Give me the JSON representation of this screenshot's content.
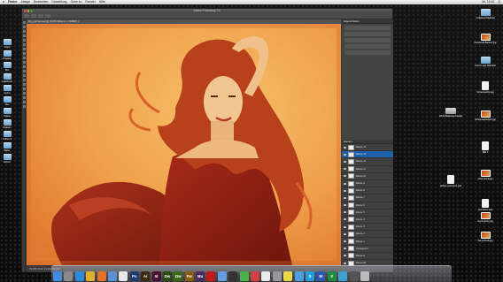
{
  "menubar": {
    "apple": "",
    "app": "Finder",
    "items": [
      "Ablage",
      "Bearbeiten",
      "Darstellung",
      "Gehe zu",
      "Fenster",
      "Hilfe"
    ],
    "status": [
      "Mi. 16:42",
      "Q"
    ]
  },
  "photoshop": {
    "window_title": "Adobe Photoshop CC",
    "doc_tab": "fire_portrait.psd @ 33,3% (Ebene 1, RGB/8) ×",
    "status": "33,33%  Dok: 24,3M/156,8M",
    "panel_title": "Eigenschaften",
    "layers_title": "Ebenen",
    "layers": [
      "Ebene 14",
      "Ebene 13",
      "Ebene 12",
      "Ebene 11",
      "Ebene 10",
      "Ebene 9",
      "Ebene 8",
      "Ebene 7",
      "Ebene 6",
      "Ebene 5",
      "Ebene 4",
      "Ebene 3",
      "Ebene 2",
      "Ebene 1",
      "Hintergrund",
      "Ebene 0",
      "Ebene 00"
    ]
  },
  "desktop_left": [
    "Fotos",
    "Projekte",
    "Mix",
    "Lakehurst",
    "Archiv",
    "Neu",
    "Ordner",
    "Dateien",
    "Ordner 2",
    "Bilder",
    "Export"
  ],
  "desktop_right": [
    "Collateral Material",
    "Facebook-Banner.jpg",
    "Fotos Lupe Stilmittel",
    "Scheinwerfer.jpg",
    "Work Backstep Festplatte",
    "Scheinwerferlicht.jpg",
    "Bild 1",
    "pixel-stock.jpg",
    "adobe-extension.psd",
    "animation.psd",
    "stock-photo.jpg",
    "fire-portrait.jpg"
  ],
  "dock_apps": [
    {
      "name": "finder-icon",
      "label": "",
      "color": "#3d8ee0"
    },
    {
      "name": "launchpad-icon",
      "label": "",
      "color": "#8a8a8a"
    },
    {
      "name": "safari-icon",
      "label": "",
      "color": "#2a8be0"
    },
    {
      "name": "chrome-icon",
      "label": "",
      "color": "#dfb22a"
    },
    {
      "name": "firefox-icon",
      "label": "",
      "color": "#e5702a"
    },
    {
      "name": "mail-icon",
      "label": "",
      "color": "#5b8fd8"
    },
    {
      "name": "calendar-icon",
      "label": "",
      "color": "#e8e8e8"
    },
    {
      "name": "photoshop-icon",
      "label": "Ps",
      "color": "#1e3c6e"
    },
    {
      "name": "illustrator-icon",
      "label": "Ai",
      "color": "#3a2810"
    },
    {
      "name": "indesign-icon",
      "label": "Id",
      "color": "#4a1030"
    },
    {
      "name": "dreamweaver-icon",
      "label": "Dw",
      "color": "#2a4a10"
    },
    {
      "name": "dreamweaver2-icon",
      "label": "Dw",
      "color": "#3a6a18"
    },
    {
      "name": "fireworks-icon",
      "label": "Fw",
      "color": "#8a5a10"
    },
    {
      "name": "muse-icon",
      "label": "Mu",
      "color": "#4a2a60"
    },
    {
      "name": "acrobat-icon",
      "label": "",
      "color": "#c01a1a"
    },
    {
      "name": "itunes-icon",
      "label": "",
      "color": "#6a9ae0"
    },
    {
      "name": "music-icon",
      "label": "",
      "color": "#333333"
    },
    {
      "name": "messages-icon",
      "label": "",
      "color": "#4ab04a"
    },
    {
      "name": "app-icon-1",
      "label": "",
      "color": "#d04040"
    },
    {
      "name": "app-icon-2",
      "label": "",
      "color": "#eaeaea"
    },
    {
      "name": "app-icon-3",
      "label": "",
      "color": "#999999"
    },
    {
      "name": "app-icon-4",
      "label": "",
      "color": "#e8d84a"
    },
    {
      "name": "app-icon-5",
      "label": "",
      "color": "#50a0e0"
    },
    {
      "name": "skype-icon",
      "label": "S",
      "color": "#1da0e0"
    },
    {
      "name": "word-icon",
      "label": "W",
      "color": "#2a5ab0"
    },
    {
      "name": "excel-icon",
      "label": "X",
      "color": "#1e8a40"
    },
    {
      "name": "app-icon-6",
      "label": "",
      "color": "#40a0d0"
    },
    {
      "name": "app-icon-7",
      "label": "",
      "color": "#555555"
    },
    {
      "name": "trash-icon",
      "label": "",
      "color": "#bbbbbb"
    }
  ],
  "colors": {
    "canvas_light": "#f3a84a",
    "canvas_mid": "#e2742c",
    "dress": "#8e1f12",
    "hair": "#c2491a",
    "skin": "#f0c08a",
    "layer_selected": "#1d5fa8"
  }
}
